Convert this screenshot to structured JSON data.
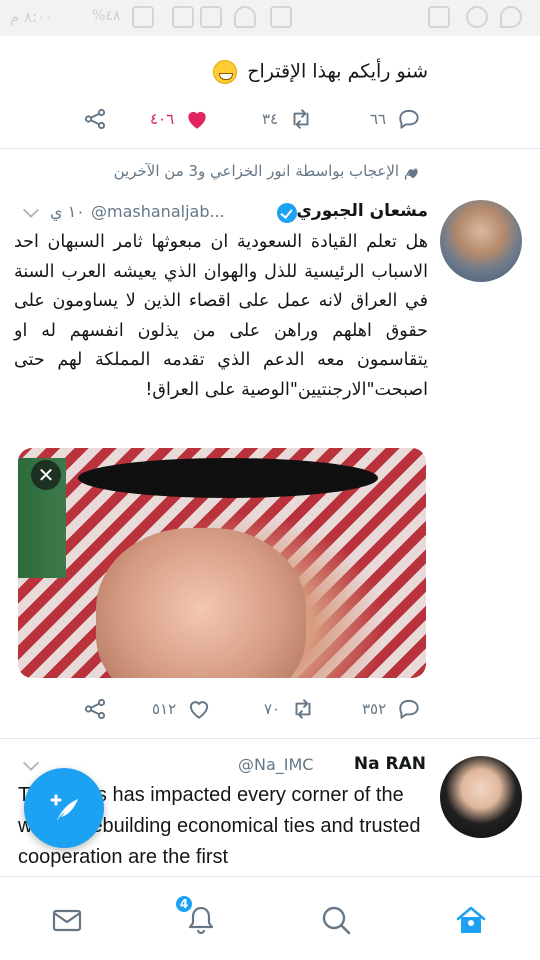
{
  "status_bar": {
    "time": "٨:٠٠ م",
    "battery": "%٤٨"
  },
  "tweet1": {
    "text": "شنو رأيكم بهذا الإقتراح",
    "replies": "٦٦",
    "retweets": "٣٤",
    "likes": "٤٠٦"
  },
  "tweet2": {
    "liked_by": "تم الإعجاب بواسطة انور الخزاعي و3 من الآخرين",
    "name": "مشعان الجبوري",
    "handle": "@mashanaljab...",
    "time": "١٠ ي",
    "text": "هل تعلم القيادة السعودية ان مبعوثها ثامر السبهان احد الاسباب الرئيسية للذل والهوان الذي يعيشه العرب السنة في العراق لانه عمل على اقصاء الذين لا يساومون على حقوق اهلهم وراهن على من يذلون انفسهم له او  يتقاسمون معه الدعم الذي تقدمه المملكة لهم حتى اصبحت\"الارجنتيين\"الوصية على العراق!",
    "replies": "٣٥٢",
    "retweets": "٧٠",
    "likes": "٥١٢"
  },
  "tweet3": {
    "name": "Na RAN",
    "handle": "@Na_IMC",
    "text": "This crisis has impacted every corner of the world. Rebuilding economical ties and trusted cooperation are the first"
  },
  "bottom_nav": {
    "notifications_badge": "4"
  },
  "colors": {
    "accent": "#1da1f2",
    "like": "#e0245e",
    "muted": "#657786"
  },
  "icons": [
    "reply-icon",
    "retweet-icon",
    "like-icon",
    "share-icon",
    "compose-icon",
    "messages-icon",
    "notifications-icon",
    "search-icon",
    "home-icon"
  ]
}
